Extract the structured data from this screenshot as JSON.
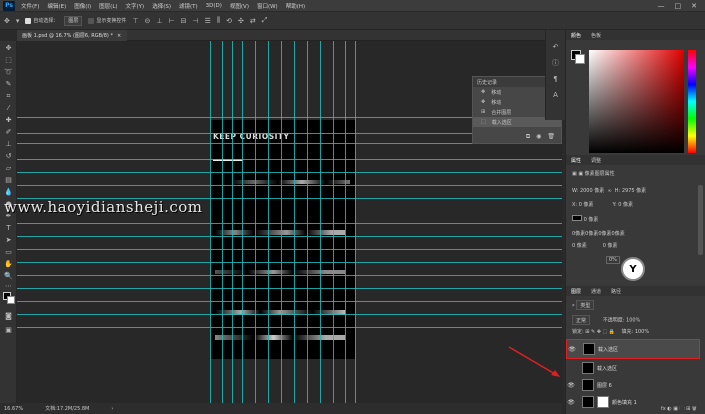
{
  "app": {
    "logo": "Ps",
    "menu": [
      "文件(F)",
      "编辑(E)",
      "图像(I)",
      "图层(L)",
      "文字(Y)",
      "选择(S)",
      "滤镜(T)",
      "3D(D)",
      "视图(V)",
      "窗口(W)",
      "帮助(H)"
    ],
    "window_controls": [
      "—",
      "□",
      "✕"
    ]
  },
  "options_bar": {
    "auto_select_label": "自动选择：",
    "auto_select_value": "图层",
    "show_transform_label": "显示变换控件"
  },
  "document": {
    "tab_title": "画板 1.psd @ 16.7% (图层6, RGB/8) *",
    "tab_close": "×",
    "artboard_text": "KEEP CURIOSITY",
    "zoom": "16.67%",
    "doc_info": "文档:17.2M/25.8M"
  },
  "watermark": "www.haoyidiansheji.com",
  "history": {
    "title": "历史记录",
    "items": [
      "移动",
      "移动",
      "合并图层",
      "载入选区"
    ],
    "active_index": 3
  },
  "color_panel": {
    "tabs": [
      "颜色",
      "色板"
    ],
    "fg": "#000000",
    "bg": "#ffffff"
  },
  "properties": {
    "tabs": [
      "属性",
      "调整"
    ],
    "kind": "像素图层属性",
    "w_label": "W:",
    "w_value": "2000 像素",
    "h_label": "H:",
    "h_value": "2975 像素",
    "x_label": "X:",
    "x_value": "0 像素",
    "y_label": "Y:",
    "y_value": "0 像素",
    "val1": "0 像素",
    "val2": "0像素0像素0像素0像素",
    "val3": "0 像素",
    "val4": "0 像素",
    "button": "0%"
  },
  "layers": {
    "tabs": [
      "图层",
      "通道",
      "路径"
    ],
    "filter": "类型",
    "blend_mode": "正常",
    "opacity_label": "不透明度:",
    "opacity": "100%",
    "lock_label": "锁定:",
    "fill_label": "填充:",
    "fill": "100%",
    "items": [
      {
        "name": "载入选区",
        "selected": true
      },
      {
        "name": "载入选区",
        "selected": false
      },
      {
        "name": "图层 6",
        "selected": false
      },
      {
        "name": "颜色填充 1",
        "selected": false
      }
    ]
  },
  "colors": {
    "guide": "#22bbbb",
    "highlight": "#e02020",
    "panel_bg": "#393939"
  }
}
